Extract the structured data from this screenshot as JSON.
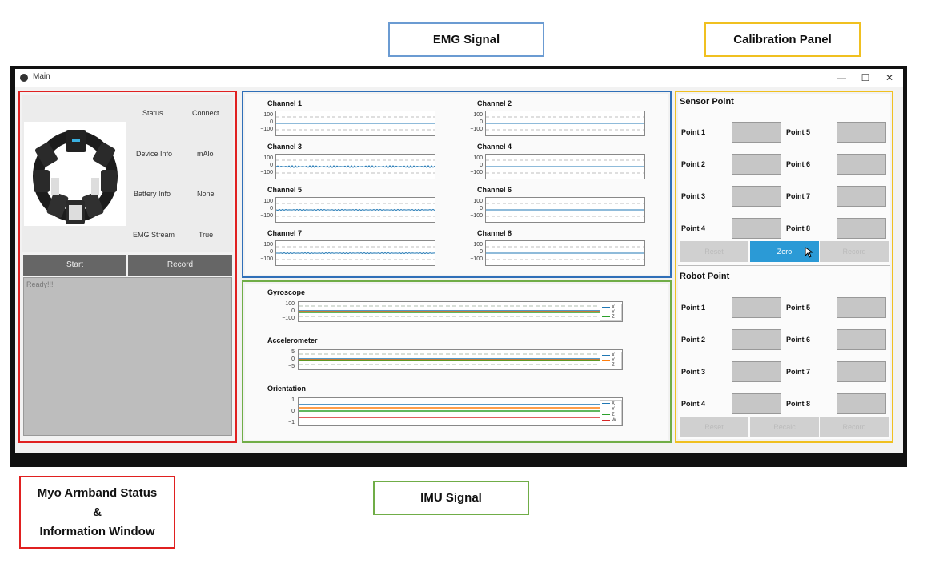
{
  "callouts": {
    "emg": "EMG Signal",
    "calibration": "Calibration Panel",
    "imu": "IMU Signal",
    "myo_line1": "Myo Armband Status",
    "myo_line2": "&",
    "myo_line3": "Information Window"
  },
  "window": {
    "title": "Main",
    "controls": [
      "—",
      "☐",
      "✕"
    ]
  },
  "status_panel": {
    "rows": [
      {
        "label": "Status",
        "value": "Connect"
      },
      {
        "label": "Device Info",
        "value": "mAlo"
      },
      {
        "label": "Battery Info",
        "value": "None"
      },
      {
        "label": "EMG Stream",
        "value": "True"
      }
    ],
    "start_label": "Start",
    "record_label": "Record",
    "log_text": "Ready!!!"
  },
  "emg": {
    "channels": [
      "Channel 1",
      "Channel 2",
      "Channel 3",
      "Channel 4",
      "Channel 5",
      "Channel 6",
      "Channel 7",
      "Channel 8"
    ],
    "ticks": [
      "100",
      "0",
      "−100"
    ]
  },
  "imu": {
    "plots": [
      {
        "title": "Gyroscope",
        "ticks": [
          "100",
          "0",
          "−100"
        ],
        "legend": [
          "X",
          "Y",
          "Z"
        ]
      },
      {
        "title": "Accelerometer",
        "ticks": [
          "5",
          "0",
          "−5"
        ],
        "legend": [
          "X",
          "Y",
          "Z"
        ]
      },
      {
        "title": "Orientation",
        "ticks": [
          "1",
          "0",
          "−1"
        ],
        "legend": [
          "X",
          "Y",
          "Z",
          "W"
        ]
      }
    ],
    "colors": {
      "X": "#1f77b4",
      "Y": "#ff7f0e",
      "Z": "#2ca02c",
      "W": "#d62728"
    }
  },
  "calibration": {
    "sensor_title": "Sensor Point",
    "robot_title": "Robot Point",
    "sensor_points": [
      "Point 1",
      "Point 2",
      "Point 3",
      "Point 4",
      "Point 5",
      "Point 6",
      "Point 7",
      "Point 8"
    ],
    "robot_points": [
      "Point 1",
      "Point 2",
      "Point 3",
      "Point 4",
      "Point 5",
      "Point 6",
      "Point 7",
      "Point 8"
    ],
    "sensor_buttons": [
      "Reset",
      "Zero",
      "Record"
    ],
    "robot_buttons": [
      "Reset",
      "Recalc",
      "Record"
    ],
    "accent": "#2b9ad6"
  }
}
